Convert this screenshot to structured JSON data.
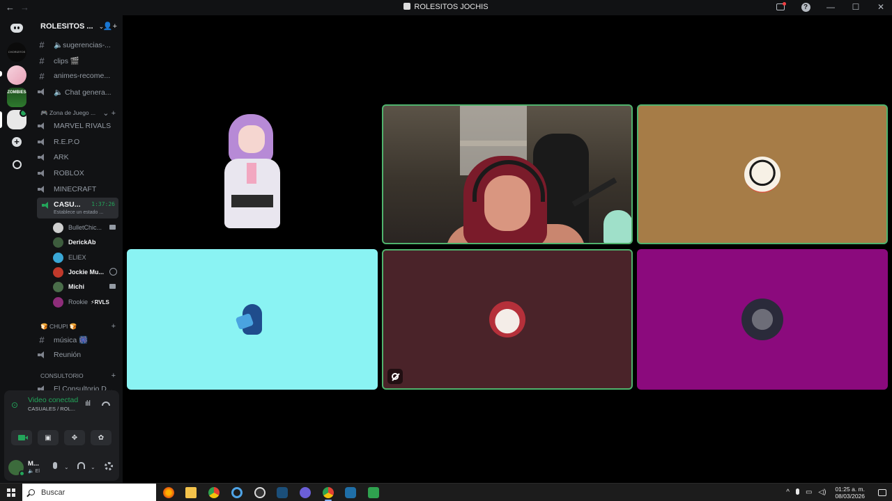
{
  "window": {
    "title": "ROLESITOS JOCHIS",
    "back": "←",
    "forward": "→",
    "help": "?",
    "minimize": "—",
    "maximize": "☐",
    "close": "✕"
  },
  "server": {
    "name": "ROLESITOS ...",
    "chevron": "⌄",
    "invite_icon": "👤+"
  },
  "rail": {
    "servers": [
      "srv-1",
      "srv-2",
      "ZOMBIES",
      "srv-4"
    ],
    "add_label": "+"
  },
  "channels": {
    "top": [
      {
        "type": "text",
        "label": "🔈sugerencias-..."
      },
      {
        "type": "text",
        "label": "clips 🎬"
      },
      {
        "type": "text",
        "label": "animes-recome..."
      },
      {
        "type": "voice",
        "label": "🔈 Chat genera..."
      }
    ],
    "zona": {
      "category": "🎮 Zona de Juego ...",
      "items": [
        "MARVEL RIVALS",
        "R.E.P.O",
        "ARK",
        "ROBLOX",
        "MINECRAFT"
      ]
    },
    "active": {
      "name": "CASU...",
      "timer": "1:37:26",
      "status": "Establece un estado ..."
    },
    "voice_users": [
      {
        "name": "BulletChic...",
        "bold": false,
        "color": "#cfcfcf",
        "icon": "camera"
      },
      {
        "name": "DerickAb",
        "bold": true,
        "color": "#3d5c3d",
        "icon": ""
      },
      {
        "name": "ELIEX",
        "bold": false,
        "color": "#3aa7d6",
        "icon": ""
      },
      {
        "name": "Jockie Mu...",
        "bold": true,
        "color": "#c0392b",
        "icon": "dnd"
      },
      {
        "name": "Michi",
        "bold": true,
        "color": "#4a6d4a",
        "icon": "camera"
      },
      {
        "name": "Rookie",
        "bold": false,
        "color": "#8e2d7a",
        "icon": "",
        "tag": "⚡RVLS"
      }
    ],
    "chupi": {
      "category": "🍞 CHUPI 🍞",
      "items": [
        {
          "type": "text",
          "label": "música 🎆"
        },
        {
          "type": "voice",
          "label": "Reunión"
        }
      ]
    },
    "consultorio": {
      "category": "CONSULTORIO",
      "items": [
        {
          "type": "voice",
          "label": "El Consultorio D..."
        }
      ]
    }
  },
  "voice_panel": {
    "status": "Video conectado",
    "location": "CASUALES / ROL...",
    "user_name": "M...",
    "user_sub": "🔈 El"
  },
  "tiles": [
    {
      "id": "vtuber",
      "color": "#000000"
    },
    {
      "id": "camera",
      "color": "#3a342c"
    },
    {
      "id": "brown",
      "color": "#a67c47",
      "avatar": "#f0e6d8"
    },
    {
      "id": "cyan",
      "color": "#8af3f3",
      "avatar": "#1f4c8c"
    },
    {
      "id": "maroon",
      "color": "#4a2329",
      "avatar": "#ece4e0"
    },
    {
      "id": "magenta",
      "color": "#8b0a7d",
      "avatar": "#2a2a3a"
    }
  ],
  "taskbar": {
    "search_placeholder": "Buscar",
    "time": "01:25 a. m.",
    "date": "08/03/2026",
    "tray_chevron": "^"
  }
}
